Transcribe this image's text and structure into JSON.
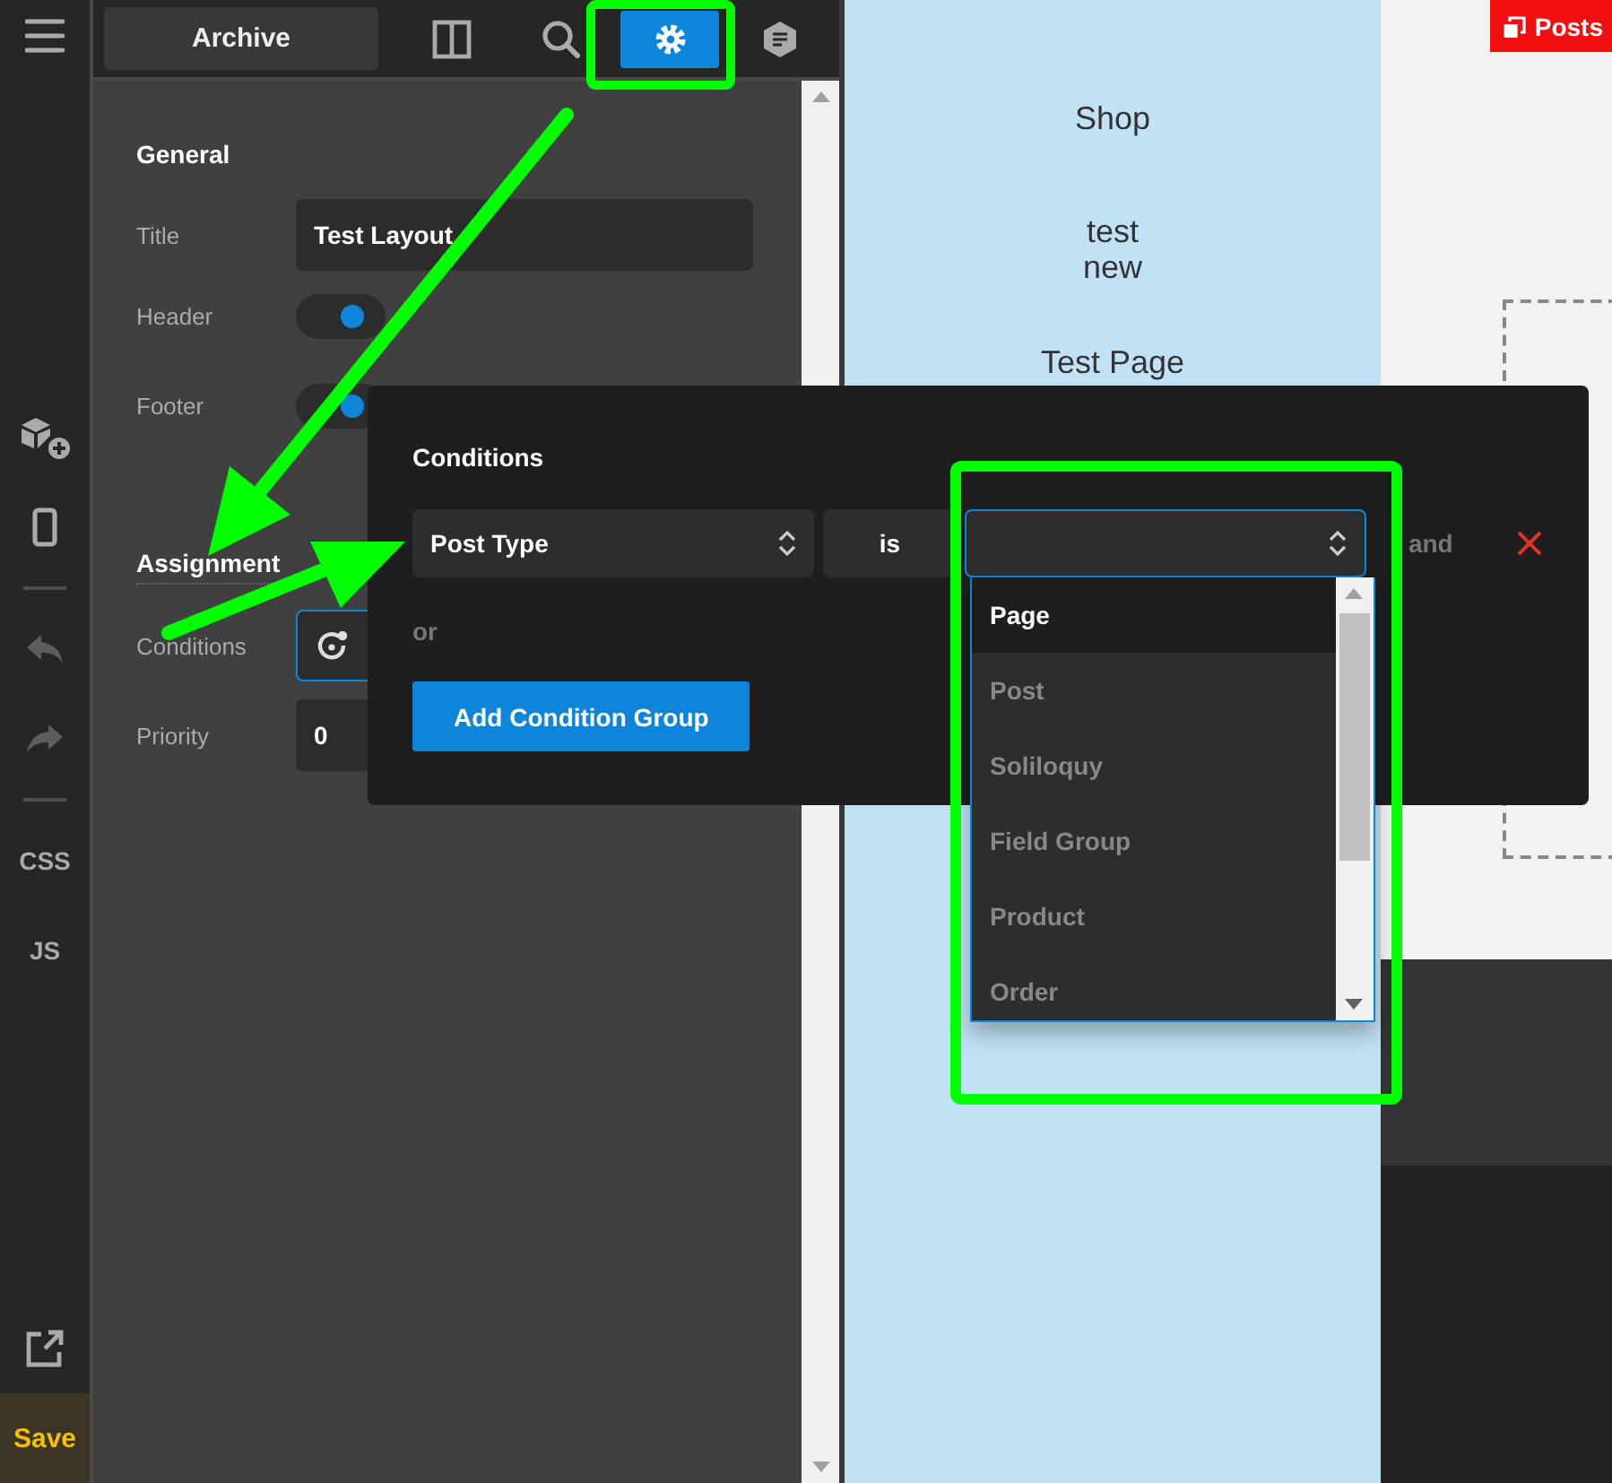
{
  "rail": [
    {
      "kind": "menu",
      "disabled": false
    },
    {
      "kind": "add-element",
      "disabled": false
    },
    {
      "kind": "device",
      "disabled": false
    },
    {
      "kind": "divider"
    },
    {
      "kind": "undo",
      "disabled": true
    },
    {
      "kind": "redo",
      "disabled": true
    },
    {
      "kind": "divider"
    },
    {
      "kind": "text",
      "label": "CSS",
      "disabled": false
    },
    {
      "kind": "text",
      "label": "JS",
      "disabled": false
    },
    {
      "kind": "open-link",
      "disabled": false
    },
    {
      "kind": "save",
      "label": "Save",
      "disabled": false
    }
  ],
  "panel": {
    "template_label": "Archive",
    "tabs": [
      {
        "kind": "columns",
        "selected": false
      },
      {
        "kind": "search",
        "selected": false
      },
      {
        "kind": "settings",
        "selected": true
      },
      {
        "kind": "note",
        "selected": false
      }
    ],
    "sections": [
      {
        "title": "General",
        "fields": [
          {
            "kind": "text",
            "label": "Title",
            "value": "Test Layout"
          },
          {
            "kind": "toggle",
            "label": "Header",
            "on": true
          },
          {
            "kind": "toggle",
            "label": "Footer",
            "on": true
          }
        ]
      },
      {
        "title": "Assignment",
        "fields": [
          {
            "kind": "conditions",
            "label": "Conditions"
          },
          {
            "kind": "text",
            "label": "Priority",
            "value": "0"
          }
        ]
      }
    ]
  },
  "canvas": {
    "menu_items": [
      "Shop",
      "test\nnew",
      "Test Page"
    ],
    "badge": "Posts"
  },
  "conditions_popup": {
    "title": "Conditions",
    "rule": {
      "field": "Post Type",
      "operator": "is",
      "joiner": "and"
    },
    "or_label": "or",
    "add_button": "Add Condition Group",
    "options": [
      {
        "label": "Page",
        "selected": true
      },
      {
        "label": "Post",
        "selected": false
      },
      {
        "label": "Soliloquy",
        "selected": false
      },
      {
        "label": "Field Group",
        "selected": false
      },
      {
        "label": "Product",
        "selected": false
      },
      {
        "label": "Order",
        "selected": false
      }
    ]
  }
}
